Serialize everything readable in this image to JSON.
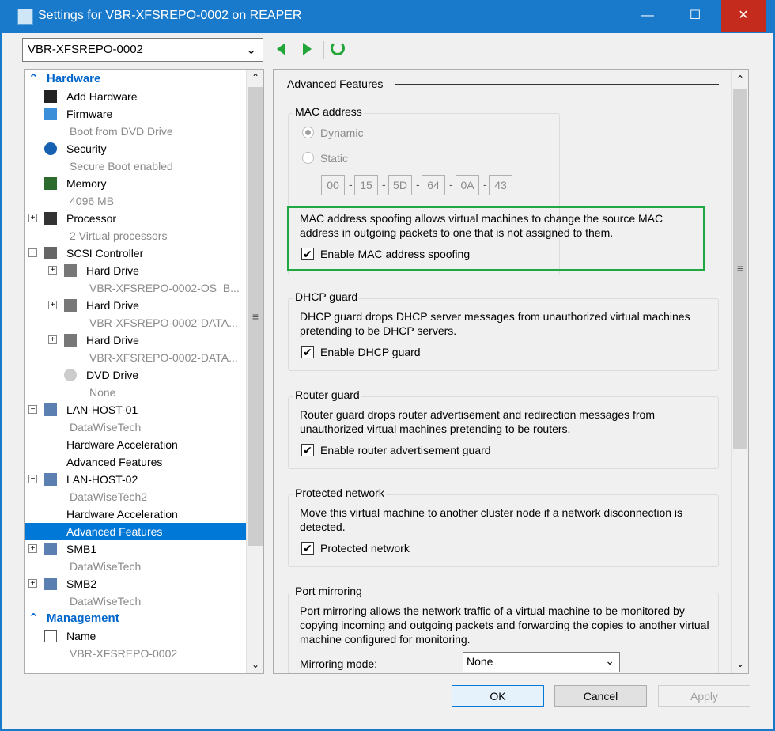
{
  "window": {
    "title": "Settings for VBR-XFSREPO-0002 on REAPER",
    "minimize": "—",
    "maximize": "☐",
    "close": "✕"
  },
  "toolbar": {
    "vm": "VBR-XFSREPO-0002"
  },
  "tree": [
    {
      "t": "Hardware",
      "kind": "hdr",
      "lvl": 0,
      "icon": "collapse-chevrons-icon"
    },
    {
      "t": "Add Hardware",
      "lvl": 1,
      "icon": "add-hardware-icon"
    },
    {
      "t": "Firmware",
      "lvl": 1,
      "icon": "firmware-icon"
    },
    {
      "t": "Boot from DVD Drive",
      "lvl": 1,
      "kind": "sub"
    },
    {
      "t": "Security",
      "lvl": 1,
      "icon": "shield-icon"
    },
    {
      "t": "Secure Boot enabled",
      "lvl": 1,
      "kind": "sub"
    },
    {
      "t": "Memory",
      "lvl": 1,
      "icon": "memory-icon"
    },
    {
      "t": "4096 MB",
      "lvl": 1,
      "kind": "sub"
    },
    {
      "t": "Processor",
      "lvl": 1,
      "icon": "processor-icon",
      "exp": "+"
    },
    {
      "t": "2 Virtual processors",
      "lvl": 1,
      "kind": "sub"
    },
    {
      "t": "SCSI Controller",
      "lvl": 1,
      "icon": "scsi-icon",
      "exp": "−"
    },
    {
      "t": "Hard Drive",
      "lvl": 2,
      "icon": "hard-drive-icon",
      "exp": "+"
    },
    {
      "t": "VBR-XFSREPO-0002-OS_B...",
      "lvl": 2,
      "kind": "sub"
    },
    {
      "t": "Hard Drive",
      "lvl": 2,
      "icon": "hard-drive-icon",
      "exp": "+"
    },
    {
      "t": "VBR-XFSREPO-0002-DATA...",
      "lvl": 2,
      "kind": "sub"
    },
    {
      "t": "Hard Drive",
      "lvl": 2,
      "icon": "hard-drive-icon",
      "exp": "+"
    },
    {
      "t": "VBR-XFSREPO-0002-DATA...",
      "lvl": 2,
      "kind": "sub"
    },
    {
      "t": "DVD Drive",
      "lvl": 2,
      "icon": "dvd-icon"
    },
    {
      "t": "None",
      "lvl": 2,
      "kind": "sub"
    },
    {
      "t": "LAN-HOST-01",
      "lvl": 1,
      "icon": "network-adapter-icon",
      "exp": "−"
    },
    {
      "t": "DataWiseTech",
      "lvl": 1,
      "kind": "sub"
    },
    {
      "t": "Hardware Acceleration",
      "lvl": 1
    },
    {
      "t": "Advanced Features",
      "lvl": 1
    },
    {
      "t": "LAN-HOST-02",
      "lvl": 1,
      "icon": "network-adapter-icon",
      "exp": "−"
    },
    {
      "t": "DataWiseTech2",
      "lvl": 1,
      "kind": "sub"
    },
    {
      "t": "Hardware Acceleration",
      "lvl": 1
    },
    {
      "t": "Advanced Features",
      "lvl": 1,
      "kind": "sel"
    },
    {
      "t": "SMB1",
      "lvl": 1,
      "icon": "network-adapter-icon",
      "exp": "+"
    },
    {
      "t": "DataWiseTech",
      "lvl": 1,
      "kind": "sub"
    },
    {
      "t": "SMB2",
      "lvl": 1,
      "icon": "network-adapter-icon",
      "exp": "+"
    },
    {
      "t": "DataWiseTech",
      "lvl": 1,
      "kind": "sub"
    },
    {
      "t": "Management",
      "kind": "hdr",
      "lvl": 0,
      "icon": "collapse-chevrons-icon"
    },
    {
      "t": "Name",
      "lvl": 1,
      "icon": "name-icon"
    },
    {
      "t": "VBR-XFSREPO-0002",
      "lvl": 1,
      "kind": "sub"
    }
  ],
  "panel": {
    "title": "Advanced Features",
    "mac": {
      "label": "MAC address",
      "dynamic": "Dynamic",
      "static": "Static",
      "selected": "Dynamic",
      "octets": [
        "00",
        "15",
        "5D",
        "64",
        "0A",
        "43"
      ],
      "spoof_desc": "MAC address spoofing allows virtual machines to change the source MAC address in outgoing packets to one that is not assigned to them.",
      "spoof_label": "Enable MAC address spoofing",
      "spoof_checked": true,
      "highlight": "#1fa83f"
    },
    "dhcp": {
      "label": "DHCP guard",
      "desc": "DHCP guard drops DHCP server messages from unauthorized virtual machines pretending to be DHCP servers.",
      "check": "Enable DHCP guard",
      "checked": true
    },
    "router": {
      "label": "Router guard",
      "desc": "Router guard drops router advertisement and redirection messages from unauthorized virtual machines pretending to be routers.",
      "check": "Enable router advertisement guard",
      "checked": true
    },
    "protected": {
      "label": "Protected network",
      "desc": "Move this virtual machine to another cluster node if a network disconnection is detected.",
      "check": "Protected network",
      "checked": true
    },
    "mirror": {
      "label": "Port mirroring",
      "desc": "Port mirroring allows the network traffic of a virtual machine to be monitored by copying incoming and outgoing packets and forwarding the copies to another virtual machine configured for monitoring.",
      "mode_label": "Mirroring mode:",
      "mode_value": "None"
    }
  },
  "buttons": {
    "ok": "OK",
    "cancel": "Cancel",
    "apply": "Apply"
  }
}
